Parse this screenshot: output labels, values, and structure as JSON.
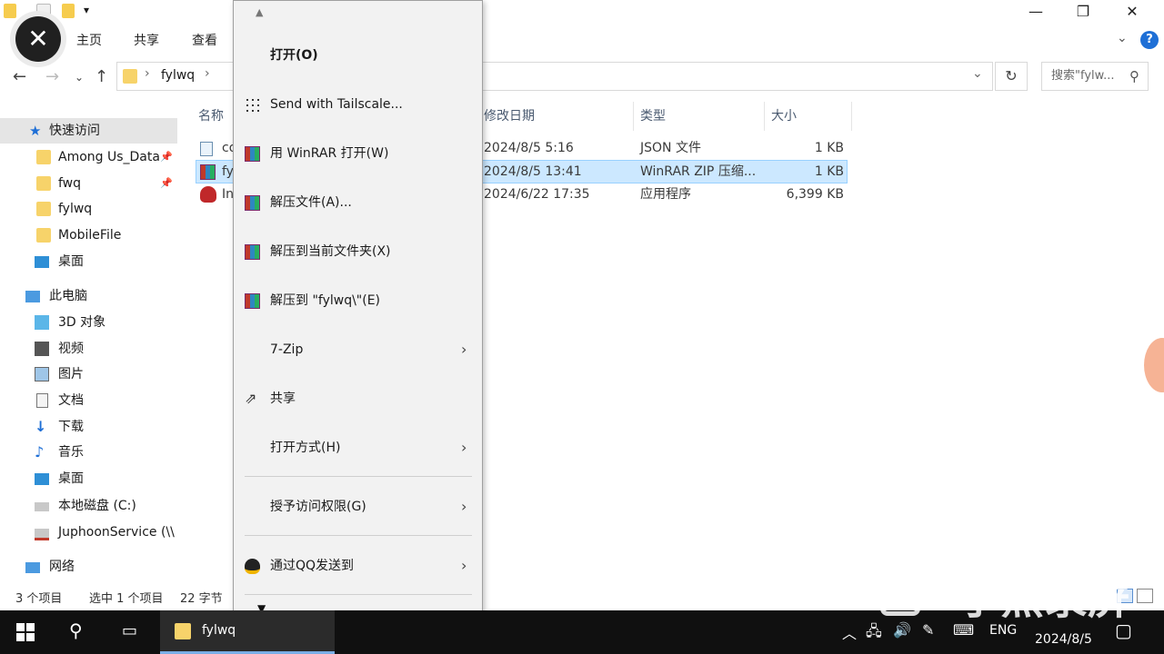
{
  "window": {
    "ribbon_tabs": [
      "主页",
      "共享",
      "查看"
    ],
    "controls": {
      "minimize": "—",
      "maximize": "❐",
      "close": "✕"
    }
  },
  "address": {
    "path_segment": "fylwq",
    "search_placeholder": "搜索\"fylw...",
    "dropdown_glyph": "⌄",
    "refresh_glyph": "↻",
    "search_glyph": "⚲"
  },
  "nav": {
    "quick_access": "快速访问",
    "items": [
      "Among Us_Data",
      "fwq",
      "fylwq",
      "MobileFile",
      "桌面"
    ],
    "this_pc": "此电脑",
    "pc_items": [
      "3D 对象",
      "视频",
      "图片",
      "文档",
      "下载",
      "音乐",
      "桌面",
      "本地磁盘 (C:)",
      "JuphoonService (\\\\"
    ],
    "network": "网络"
  },
  "files": {
    "columns": {
      "name": "名称",
      "date": "修改日期",
      "type": "类型",
      "size": "大小"
    },
    "rows": [
      {
        "name": "co",
        "date": "2024/8/5 5:16",
        "type": "JSON 文件",
        "size": "1 KB"
      },
      {
        "name": "fy",
        "date": "2024/8/5 13:41",
        "type": "WinRAR ZIP 压缩...",
        "size": "1 KB"
      },
      {
        "name": "In",
        "date": "2024/6/22 17:35",
        "type": "应用程序",
        "size": "6,399 KB"
      }
    ]
  },
  "status": {
    "count": "3 个项目",
    "selected": "选中 1 个项目",
    "size": "22 字节"
  },
  "context_menu": {
    "scroll_up": "▲",
    "scroll_down": "▼",
    "items": [
      {
        "label": "打开(O)",
        "bold": true
      },
      {
        "label": "Send with Tailscale..."
      },
      {
        "label": "用 WinRAR 打开(W)"
      },
      {
        "label": "解压文件(A)..."
      },
      {
        "label": "解压到当前文件夹(X)"
      },
      {
        "label": "解压到 \"fylwq\\\"(E)"
      },
      {
        "label": "7-Zip",
        "submenu": true
      },
      {
        "label": "共享"
      },
      {
        "label": "打开方式(H)",
        "submenu": true
      },
      {
        "label": "授予访问权限(G)",
        "submenu": true
      },
      {
        "label": "通过QQ发送到",
        "submenu": true
      }
    ]
  },
  "taskbar": {
    "app_label": "fylwq",
    "lang": "ENG",
    "date": "2024/8/5"
  },
  "watermark": "小熊录屏",
  "colors": {
    "accent": "#1e6fd6",
    "selection": "#cce8ff",
    "folder": "#f7d36a",
    "taskbar": "#101010"
  }
}
